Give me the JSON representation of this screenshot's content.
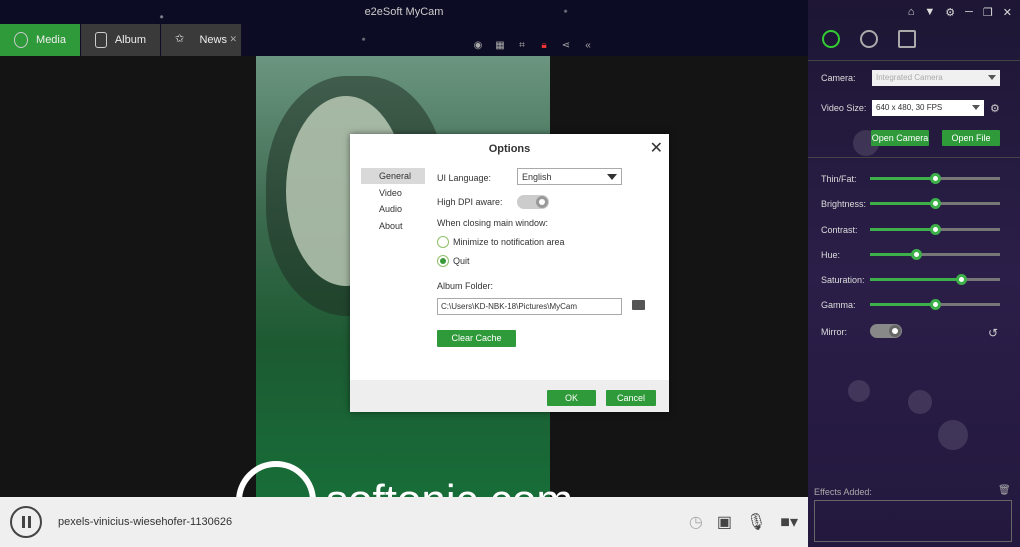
{
  "app": {
    "title": "e2eSoft MyCam"
  },
  "tabs": [
    {
      "label": "Media",
      "active": true
    },
    {
      "label": "Album",
      "active": false
    },
    {
      "label": "News",
      "active": false
    }
  ],
  "toolbar_icons": [
    "broadcast-icon",
    "qr-icon",
    "crop-icon",
    "lock-icon",
    "share-icon",
    "collapse-icon"
  ],
  "media": {
    "filename": "pexels-vinicius-wiesehofer-1130626",
    "watermark": "softonic.com"
  },
  "bottom_icons": [
    "timer-icon",
    "save-icon",
    "microphone-icon",
    "video-camera-icon"
  ],
  "panel": {
    "camera_label": "Camera:",
    "camera_value": "Integrated Camera",
    "video_size_label": "Video Size:",
    "video_size_value": "640 x 480, 30 FPS",
    "open_camera": "Open Camera",
    "open_file": "Open File",
    "sliders": [
      {
        "label": "Thin/Fat:",
        "value": 0.5
      },
      {
        "label": "Brightness:",
        "value": 0.5
      },
      {
        "label": "Contrast:",
        "value": 0.5
      },
      {
        "label": "Hue:",
        "value": 0.35
      },
      {
        "label": "Saturation:",
        "value": 0.7
      },
      {
        "label": "Gamma:",
        "value": 0.5
      }
    ],
    "mirror_label": "Mirror:",
    "effects_label": "Effects Added:"
  },
  "dialog": {
    "title": "Options",
    "nav": [
      "General",
      "Video",
      "Audio",
      "About"
    ],
    "ui_language_label": "UI Language:",
    "ui_language_value": "English",
    "high_dpi_label": "High DPI aware:",
    "closing_label": "When closing main window:",
    "option_minimize": "Minimize to notification area",
    "option_quit": "Quit",
    "album_folder_label": "Album Folder:",
    "album_folder_value": "C:\\Users\\KD-NBK-18\\Pictures\\MyCam",
    "clear_cache": "Clear Cache",
    "ok": "OK",
    "cancel": "Cancel"
  },
  "colors": {
    "accent": "#2f9a3a",
    "panel_bg": "#2b1e48",
    "topbar_bg": "#13132e"
  }
}
